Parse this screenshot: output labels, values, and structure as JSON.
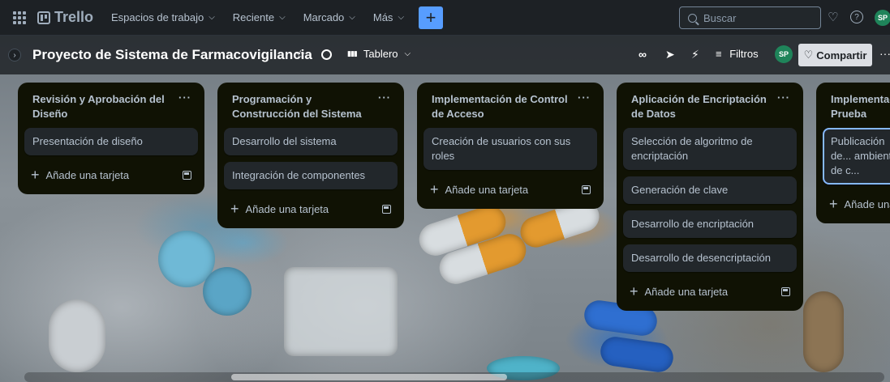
{
  "topbar": {
    "brand": "Trello",
    "nav": [
      {
        "label": "Espacios de trabajo"
      },
      {
        "label": "Reciente"
      },
      {
        "label": "Marcado"
      },
      {
        "label": "Más"
      }
    ],
    "create_label": "+",
    "search_placeholder": "Buscar",
    "avatar_initials": "SP"
  },
  "board": {
    "title": "Proyecto de Sistema de Farmacovigilancia",
    "view_label": "Tablero",
    "filters_label": "Filtros",
    "member_initials": "SP",
    "share_label": "Compartir",
    "more_label": "···"
  },
  "lists": [
    {
      "title": "Revisión y Aprobación del Diseño",
      "cards": [
        "Presentación de diseño"
      ],
      "add_label": "Añade una tarjeta"
    },
    {
      "title": "Programación y Construcción del Sistema",
      "cards": [
        "Desarrollo del sistema",
        "Integración de componentes"
      ],
      "add_label": "Añade una tarjeta"
    },
    {
      "title": "Implementación de Control de Acceso",
      "cards": [
        "Creación de usuarios con sus roles"
      ],
      "add_label": "Añade una tarjeta"
    },
    {
      "title": "Aplicación de Encriptación de Datos",
      "cards": [
        "Selección de algoritmo de encriptación",
        "Generación de clave",
        "Desarrollo de encriptación",
        "Desarrollo de desencriptación"
      ],
      "add_label": "Añade una tarjeta"
    },
    {
      "title": "Implementaci... Prueba",
      "cards": [
        "Publicación de... ambiente de c..."
      ],
      "add_label": "Añade una"
    }
  ],
  "colors": {
    "topbar_bg": "#1d2125",
    "list_bg": "#101204",
    "card_bg": "#22272b",
    "accent": "#579dff",
    "avatar": "#1f845a"
  }
}
